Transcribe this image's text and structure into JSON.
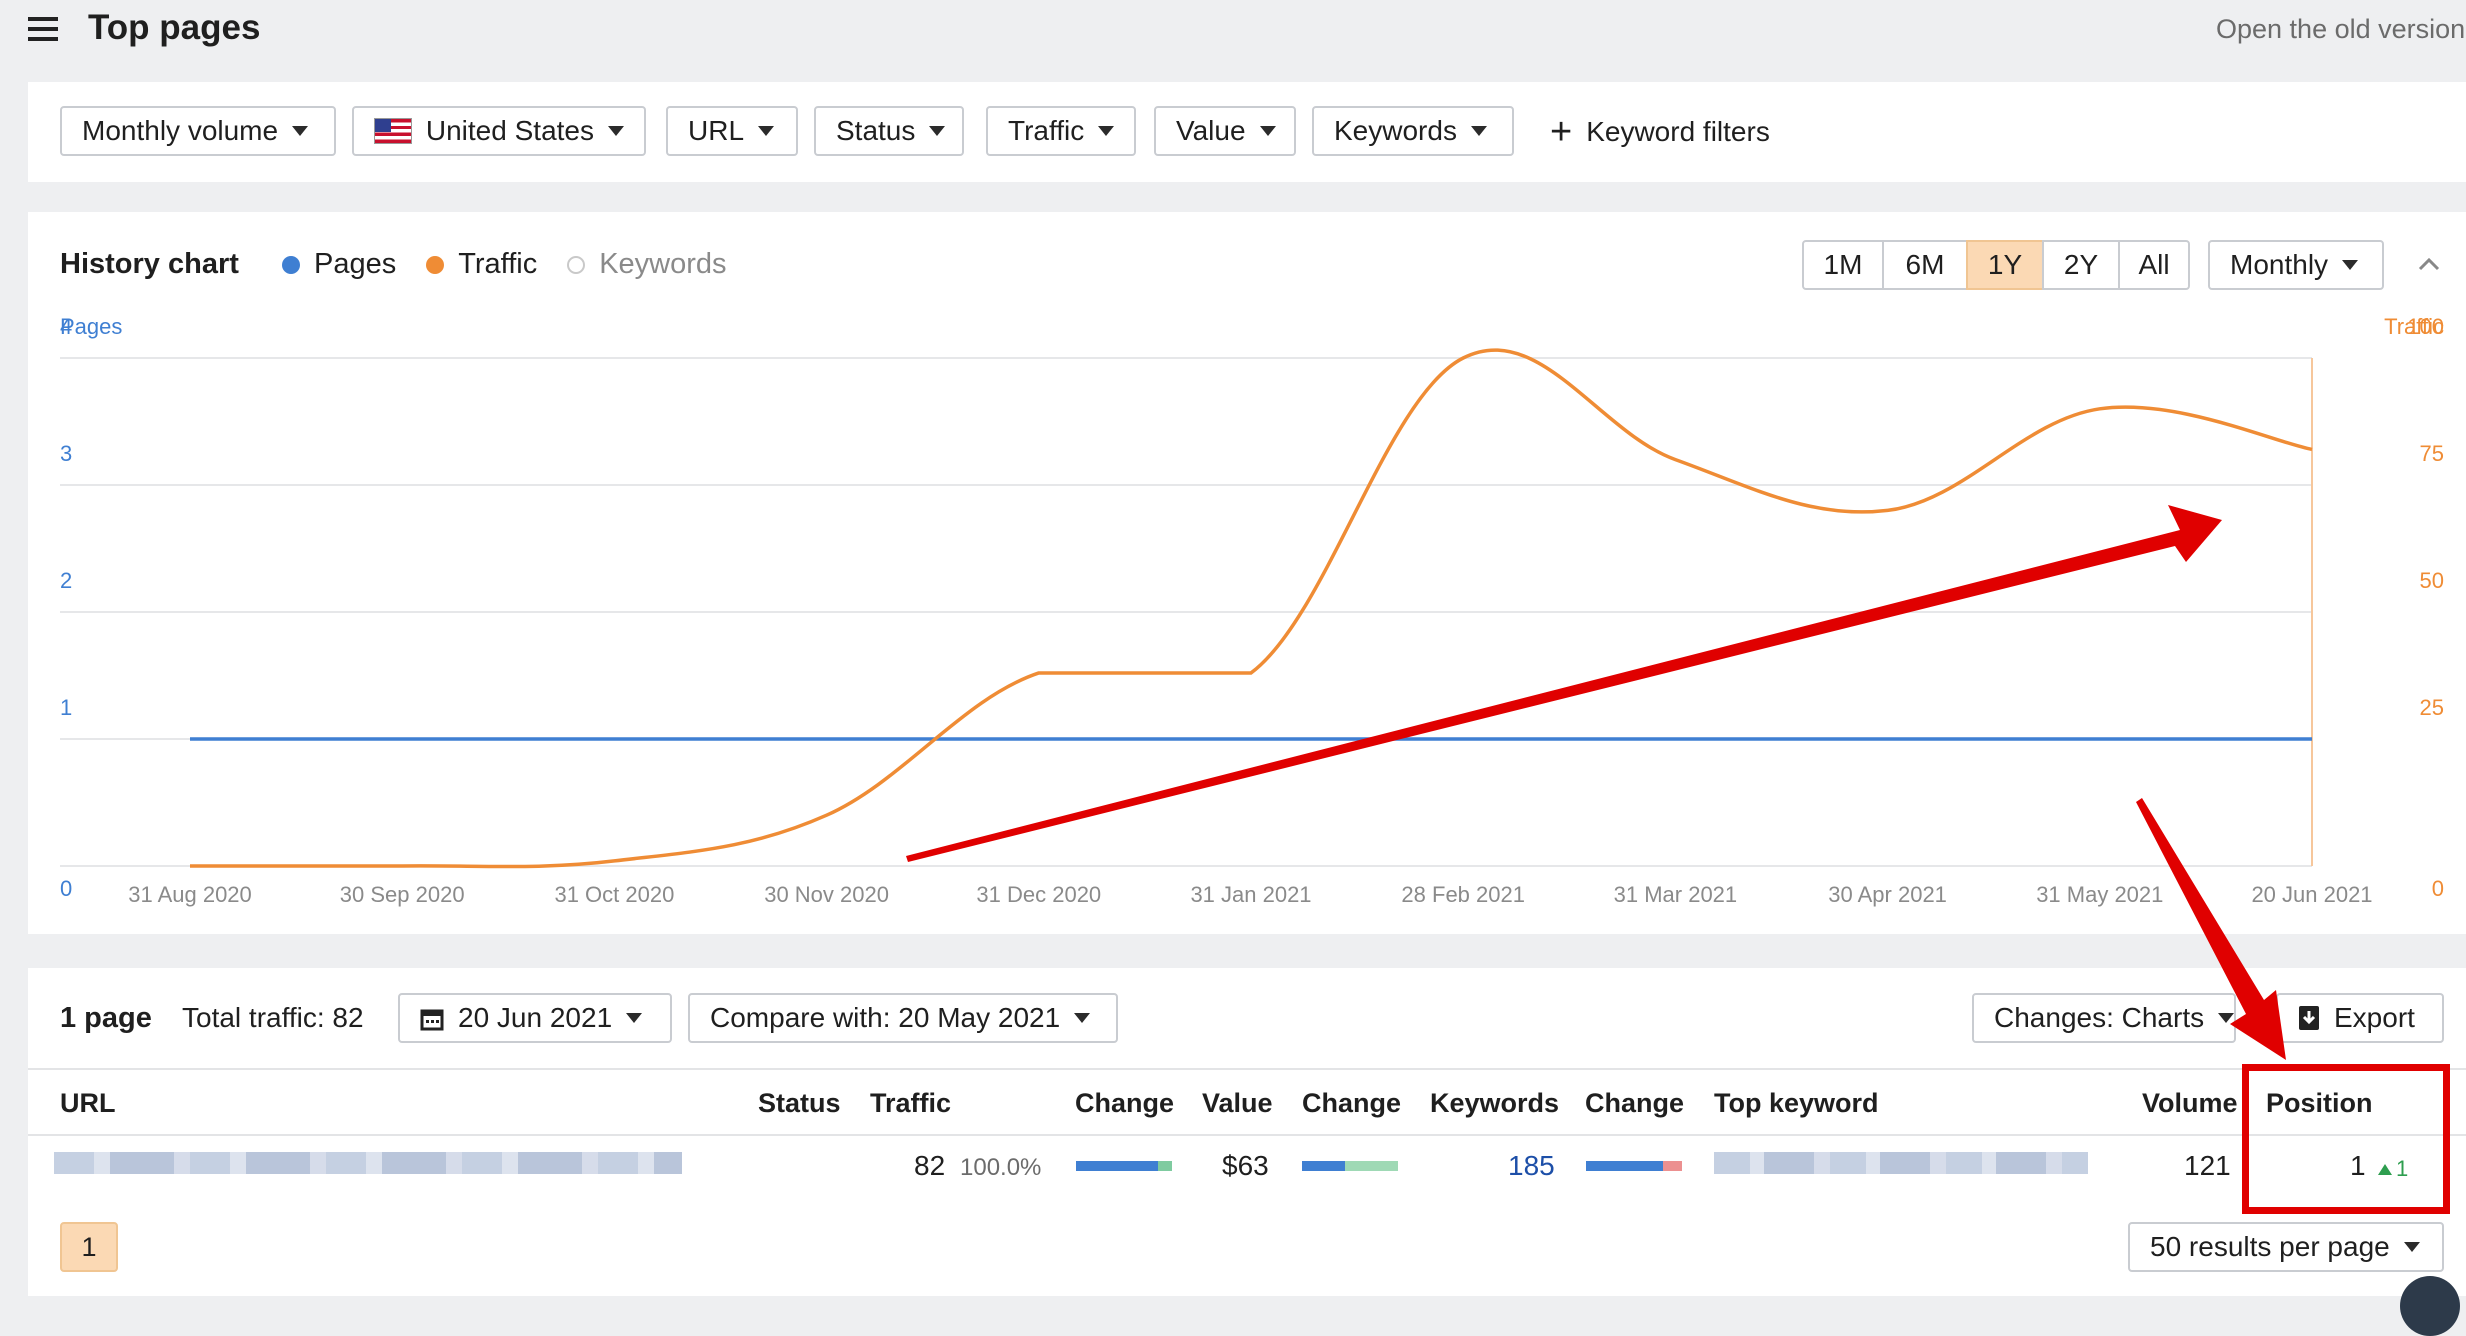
{
  "header": {
    "title": "Top pages",
    "old_version_link": "Open the old version"
  },
  "filters": {
    "monthly_volume": "Monthly volume",
    "country": "United States",
    "url": "URL",
    "status": "Status",
    "traffic": "Traffic",
    "value": "Value",
    "keywords": "Keywords",
    "keyword_filters": "Keyword filters"
  },
  "history": {
    "title": "History chart",
    "legend": {
      "pages": "Pages",
      "traffic": "Traffic",
      "keywords": "Keywords"
    },
    "ranges": [
      "1M",
      "6M",
      "1Y",
      "2Y",
      "All"
    ],
    "active_range": "1Y",
    "interval": "Monthly",
    "colors": {
      "pages": "#3f7fd2",
      "traffic": "#ef8c35",
      "keywords": "#c9c9c9",
      "annotation": "#e00000"
    }
  },
  "chart_data": {
    "type": "line",
    "left_axis_label": "Pages",
    "right_axis_label": "Traffic",
    "x": [
      "31 Aug 2020",
      "30 Sep 2020",
      "31 Oct 2020",
      "30 Nov 2020",
      "31 Dec 2020",
      "31 Jan 2021",
      "28 Feb 2021",
      "31 Mar 2021",
      "30 Apr 2021",
      "31 May 2021",
      "20 Jun 2021"
    ],
    "y_left_ticks": [
      "0",
      "1",
      "2",
      "3",
      "4"
    ],
    "y_right_ticks": [
      "0",
      "25",
      "50",
      "75",
      "100"
    ],
    "ylim_left": [
      0,
      4
    ],
    "ylim_right": [
      0,
      100
    ],
    "grid": true,
    "series": [
      {
        "name": "Pages",
        "axis": "left",
        "values": [
          1,
          1,
          1,
          1,
          1,
          1,
          1,
          1,
          1,
          1,
          1
        ]
      },
      {
        "name": "Traffic",
        "axis": "right",
        "values": [
          0,
          0,
          1,
          10,
          38,
          38,
          100,
          80,
          70,
          90,
          82
        ]
      }
    ]
  },
  "results": {
    "page_count": "1 page",
    "total_traffic": "Total traffic: 82",
    "date": "20 Jun 2021",
    "compare": "Compare with: 20 May 2021",
    "changes": "Changes: Charts",
    "export": "Export"
  },
  "table": {
    "headers": {
      "url": "URL",
      "status": "Status",
      "traffic": "Traffic",
      "change": "Change",
      "value": "Value",
      "keywords": "Keywords",
      "top_keyword": "Top keyword",
      "volume": "Volume",
      "position": "Position"
    },
    "row": {
      "traffic": "82",
      "traffic_share": "100.0%",
      "value": "$63",
      "keywords": "185",
      "volume": "121",
      "position": "1",
      "position_change": "1",
      "traffic_change_fraction": 0.85,
      "value_change_fraction": 0.45,
      "keywords_change_fraction": 0.8
    }
  },
  "pagination": {
    "current_page": "1",
    "per_page": "50 results per page"
  }
}
